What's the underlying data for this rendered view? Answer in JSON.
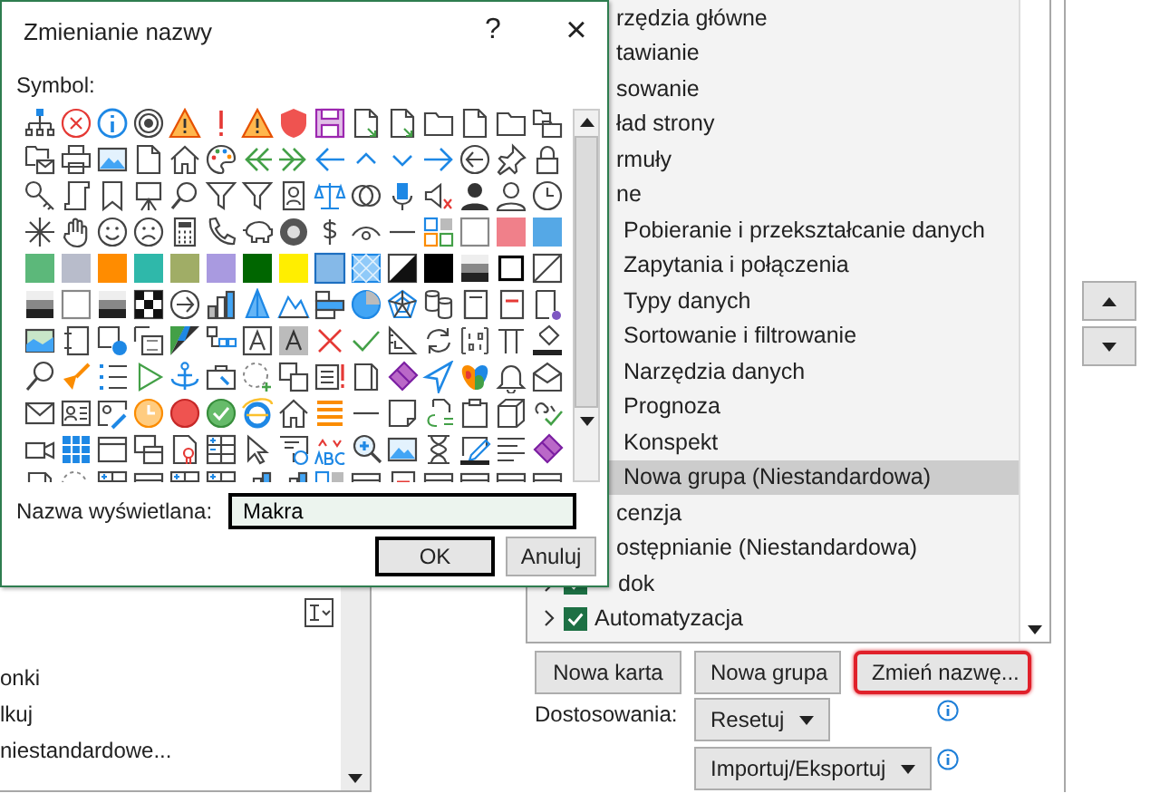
{
  "dialog": {
    "title": "Zmienianie nazwy",
    "help_button": "?",
    "close_button": "×",
    "symbol_label": "Symbol:",
    "name_field": {
      "label": "Nazwa wyświetlana:",
      "value": "Makra"
    },
    "buttons": [
      {
        "label": "OK",
        "default": true
      },
      {
        "label": "Anuluj",
        "default": false
      }
    ]
  },
  "left_panel": {
    "items": [
      "onki",
      "lkuj",
      "niestandardowe..."
    ]
  },
  "ribbon_list": {
    "items": [
      {
        "label": "rzędzia główne",
        "selected": false
      },
      {
        "label": "tawianie",
        "selected": false
      },
      {
        "label": "sowanie",
        "selected": false
      },
      {
        "label": "ład strony",
        "selected": false
      },
      {
        "label": "rmuły",
        "selected": false
      },
      {
        "label": "ne",
        "selected": false,
        "children": [
          {
            "label": "Pobieranie i przekształcanie danych",
            "selected": false
          },
          {
            "label": "Zapytania i połączenia",
            "selected": false
          },
          {
            "label": "Typy danych",
            "selected": false
          },
          {
            "label": "Sortowanie i filtrowanie",
            "selected": false
          },
          {
            "label": "Narzędzia danych",
            "selected": false
          },
          {
            "label": "Prognoza",
            "selected": false
          },
          {
            "label": "Konspekt",
            "selected": false
          },
          {
            "label": "Nowa grupa (Niestandardowa)",
            "selected": true
          }
        ]
      },
      {
        "label": "cenzja",
        "selected": false
      },
      {
        "label": "ostępnianie (Niestandardowa)",
        "selected": false
      },
      {
        "label": "dok",
        "selected": false,
        "checked": true
      },
      {
        "label": "Automatyzacja",
        "selected": false,
        "checked": true
      }
    ]
  },
  "list_buttons": [
    {
      "label": "Nowa karta",
      "highlighted": false
    },
    {
      "label": "Nowa grupa",
      "highlighted": false
    },
    {
      "label": "Zmień nazwę...",
      "highlighted": true
    }
  ],
  "customizations": {
    "label": "Dostosowania:",
    "reset_button": "Resetuj",
    "import_export_button": "Importuj/Eksportuj"
  }
}
